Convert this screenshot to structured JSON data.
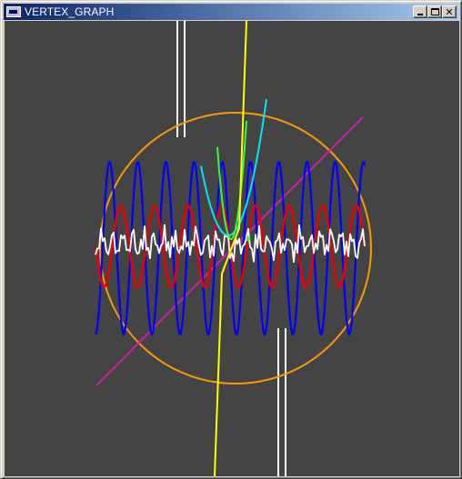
{
  "window": {
    "title": "VERTEX_GRAPH",
    "controls": {
      "minimize": "minimize",
      "maximize": "maximize",
      "close": "close"
    }
  },
  "plot": {
    "background": "#444444",
    "curves": [
      {
        "id": "vertical-white-left",
        "color": "#ffffff"
      },
      {
        "id": "vertical-white-right",
        "color": "#ffffff"
      },
      {
        "id": "parabola-cyan",
        "color": "#00e5ff"
      },
      {
        "id": "parabola-green",
        "color": "#33ff33"
      },
      {
        "id": "steep-yellow",
        "color": "#ffff00"
      },
      {
        "id": "circle-orange",
        "color": "#ff9900"
      },
      {
        "id": "diagonal-magenta",
        "color": "#cc22aa"
      },
      {
        "id": "sine-blue",
        "color": "#0000ff"
      },
      {
        "id": "sine-red",
        "color": "#ee0000"
      },
      {
        "id": "noise-white",
        "color": "#ffffff"
      }
    ]
  }
}
